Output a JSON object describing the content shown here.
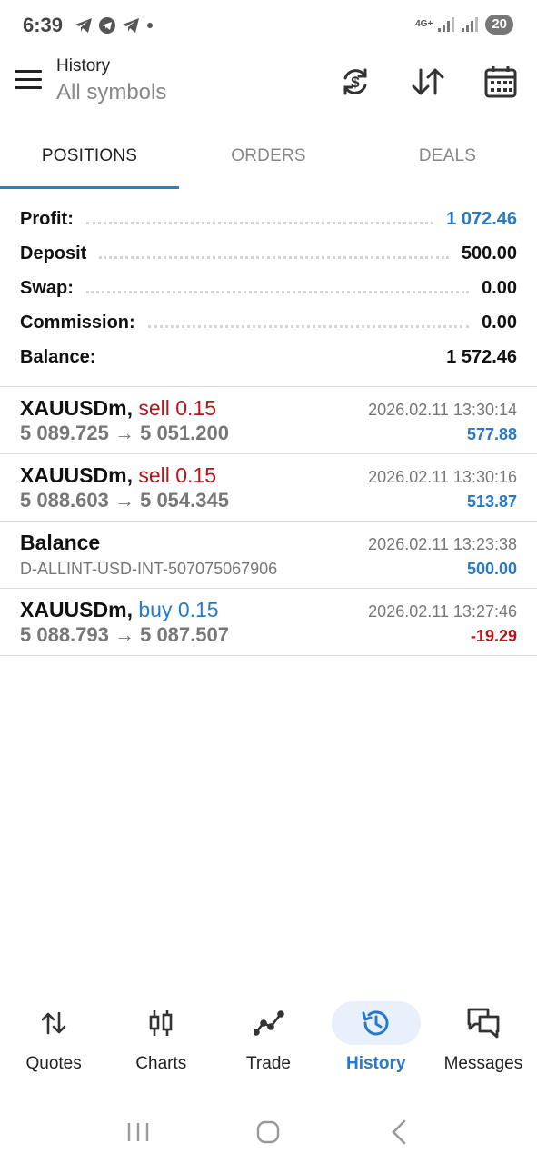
{
  "status_bar": {
    "time": "6:39",
    "network": "4G+",
    "battery": "20",
    "notification_icons": [
      "telegram-icon",
      "telegram-icon",
      "telegram-icon",
      "dot-icon"
    ]
  },
  "app_bar": {
    "title": "History",
    "subtitle": "All symbols",
    "actions": [
      "currency-exchange-icon",
      "sort-icon",
      "calendar-icon"
    ]
  },
  "tabs": [
    {
      "label": "POSITIONS",
      "active": true
    },
    {
      "label": "ORDERS",
      "active": false
    },
    {
      "label": "DEALS",
      "active": false
    }
  ],
  "summary": {
    "profit": {
      "label": "Profit:",
      "value": "1 072.46"
    },
    "deposit": {
      "label": "Deposit",
      "value": "500.00"
    },
    "swap": {
      "label": "Swap:",
      "value": "0.00"
    },
    "commission": {
      "label": "Commission:",
      "value": "0.00"
    },
    "balance": {
      "label": "Balance:",
      "value": "1 572.46"
    }
  },
  "colors": {
    "accent_blue": "#2779c9",
    "sell_red": "#b3161c",
    "tab_indicator": "#2f7dd1"
  },
  "items": [
    {
      "symbol": "XAUUSDm,",
      "side": "sell 0.15",
      "prices": "5 089.725 → 5 051.200",
      "time": "2026.02.11 13:30:14",
      "profit": "577.88"
    },
    {
      "symbol": "XAUUSDm,",
      "side": "sell 0.15",
      "prices": "5 088.603 → 5 054.345",
      "time": "2026.02.11 13:30:16",
      "profit": "513.87"
    },
    {
      "symbol": "Balance",
      "side": "",
      "prices": "D-ALLINT-USD-INT-507075067906",
      "time": "2026.02.11 13:23:38",
      "profit": "500.00"
    },
    {
      "symbol": "XAUUSDm,",
      "side": "buy 0.15",
      "prices": "5 088.793 → 5 087.507",
      "time": "2026.02.11 13:27:46",
      "profit": "-19.29"
    }
  ],
  "bottom_nav": [
    {
      "label": "Quotes",
      "icon": "quotes-icon"
    },
    {
      "label": "Charts",
      "icon": "charts-icon"
    },
    {
      "label": "Trade",
      "icon": "trade-icon"
    },
    {
      "label": "History",
      "icon": "history-icon",
      "active": true
    },
    {
      "label": "Messages",
      "icon": "messages-icon"
    }
  ]
}
